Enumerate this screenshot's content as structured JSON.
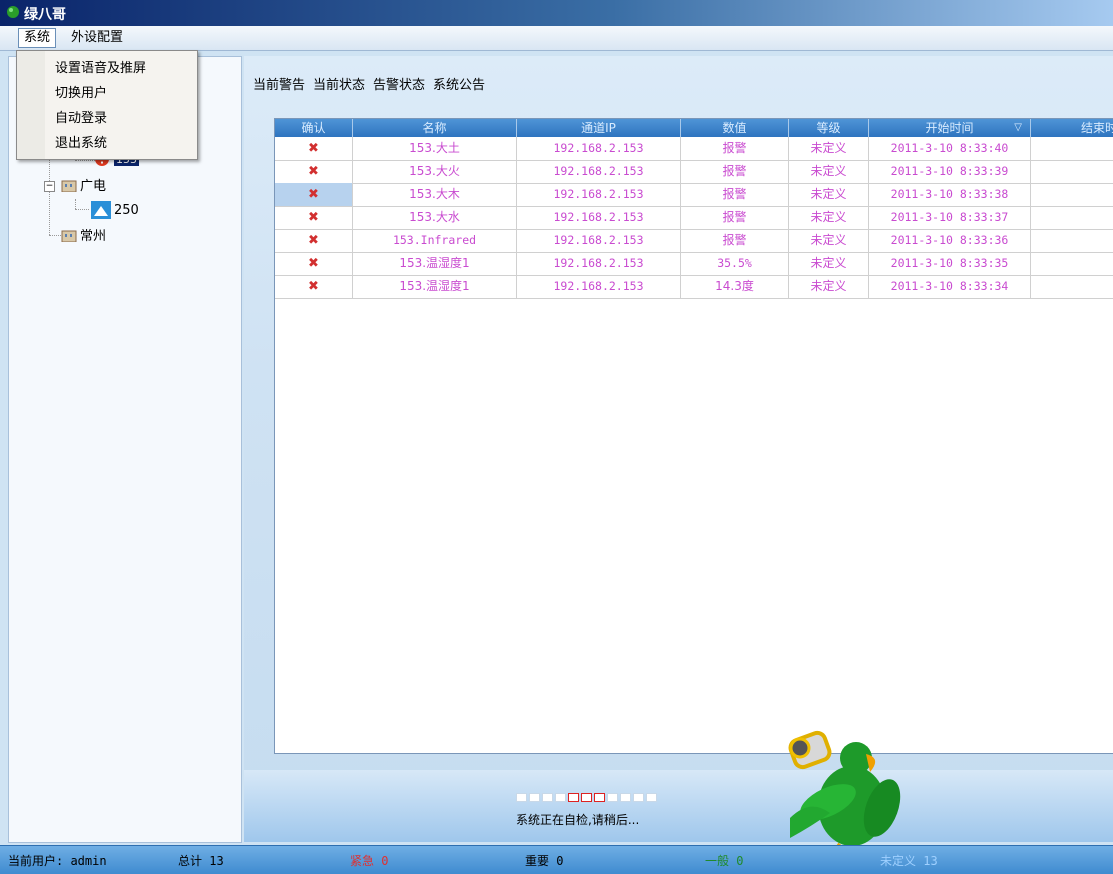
{
  "app": {
    "title": "绿八哥"
  },
  "menubar": {
    "items": [
      "系统",
      "外设配置"
    ]
  },
  "system_menu": {
    "items": [
      "设置语音及推屏",
      "切换用户",
      "自动登录",
      "退出系统"
    ]
  },
  "tree": {
    "device": "153",
    "group1": "广电",
    "device2": "250",
    "group2": "常州"
  },
  "tabs": [
    "当前警告",
    "当前状态",
    "告警状态",
    "系统公告"
  ],
  "table": {
    "columns": [
      "确认",
      "名称",
      "通道IP",
      "数值",
      "等级",
      "开始时间",
      "结束时"
    ],
    "sort_indicator": "▽",
    "ack_symbol": "✖",
    "rows": [
      {
        "name": "153.大土",
        "ip": "192.168.2.153",
        "value": "报警",
        "level": "未定义",
        "start": "2011-3-10 8:33:40"
      },
      {
        "name": "153.大火",
        "ip": "192.168.2.153",
        "value": "报警",
        "level": "未定义",
        "start": "2011-3-10 8:33:39"
      },
      {
        "name": "153.大木",
        "ip": "192.168.2.153",
        "value": "报警",
        "level": "未定义",
        "start": "2011-3-10 8:33:38"
      },
      {
        "name": "153.大水",
        "ip": "192.168.2.153",
        "value": "报警",
        "level": "未定义",
        "start": "2011-3-10 8:33:37"
      },
      {
        "name": "153.Infrared",
        "ip": "192.168.2.153",
        "value": "报警",
        "level": "未定义",
        "start": "2011-3-10 8:33:36"
      },
      {
        "name": "153.温湿度1",
        "ip": "192.168.2.153",
        "value": "35.5%",
        "level": "未定义",
        "start": "2011-3-10 8:33:35"
      },
      {
        "name": "153.温湿度1",
        "ip": "192.168.2.153",
        "value": "14.3度",
        "level": "未定义",
        "start": "2011-3-10 8:33:34"
      }
    ]
  },
  "loading": {
    "text": "系统正在自检,请稍后..."
  },
  "status": {
    "user": "当前用户: admin",
    "total": "总计 13",
    "urgent": "紧急 0",
    "important": "重要 0",
    "general": "一般 0",
    "undefined": "未定义 13"
  },
  "colors": {
    "row_text": "#c94bd0",
    "urgent": "#e03030",
    "general": "#1f8a2a",
    "undefined": "#9fd0ff"
  }
}
